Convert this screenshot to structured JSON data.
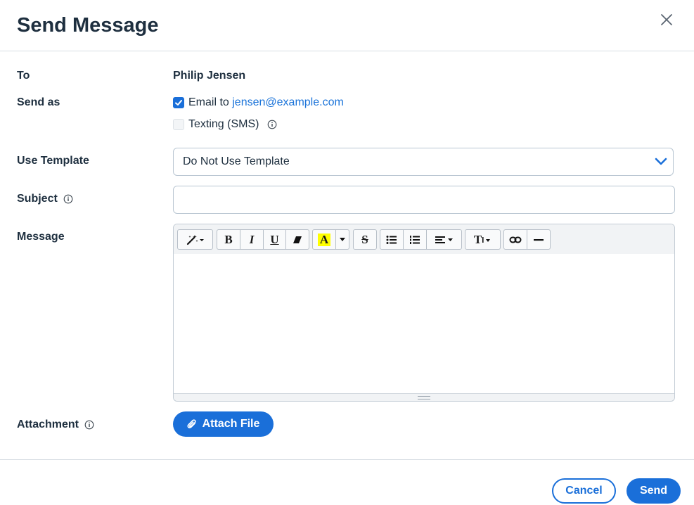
{
  "dialog": {
    "title": "Send Message",
    "close_icon": "close-icon"
  },
  "to": {
    "label": "To",
    "value": "Philip Jensen"
  },
  "send_as": {
    "label": "Send as",
    "email": {
      "checked": true,
      "prefix": "Email to",
      "address": "jensen@example.com"
    },
    "sms": {
      "checked": false,
      "label": "Texting (SMS)"
    }
  },
  "template": {
    "label": "Use Template",
    "selected": "Do Not Use Template"
  },
  "subject": {
    "label": "Subject",
    "value": "",
    "placeholder": ""
  },
  "message": {
    "label": "Message",
    "toolbar": {
      "bold": "B",
      "italic": "I",
      "underline": "U",
      "highlight": "A",
      "strikethrough": "S",
      "font_size": "T"
    },
    "body": ""
  },
  "attachment": {
    "label": "Attachment",
    "button_label": "Attach File"
  },
  "footer": {
    "cancel_label": "Cancel",
    "send_label": "Send"
  },
  "colors": {
    "accent": "#1a6fd9",
    "link": "#1a73d9",
    "text": "#1e2f3f",
    "highlight": "#ffff00"
  }
}
